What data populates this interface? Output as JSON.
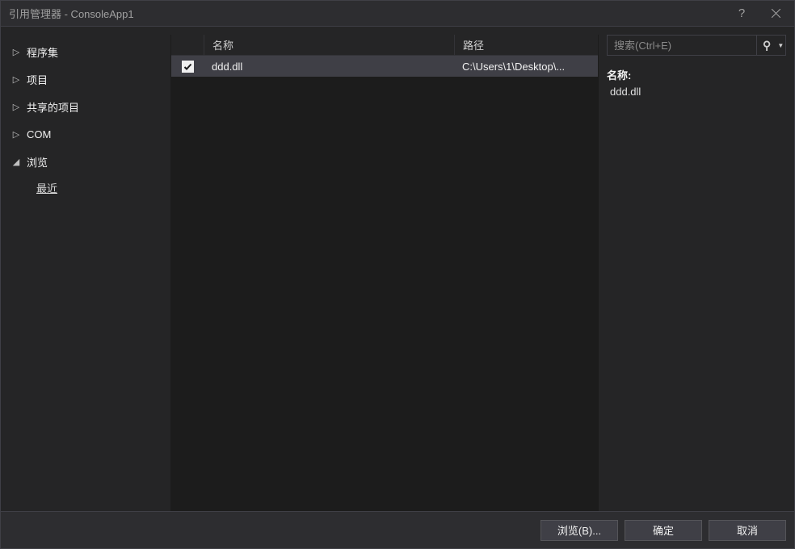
{
  "window": {
    "title": "引用管理器 - ConsoleApp1"
  },
  "sidebar": {
    "items": [
      {
        "label": "程序集",
        "expanded": false
      },
      {
        "label": "项目",
        "expanded": false
      },
      {
        "label": "共享的项目",
        "expanded": false
      },
      {
        "label": "COM",
        "expanded": false
      },
      {
        "label": "浏览",
        "expanded": true
      }
    ],
    "browse_sub": "最近"
  },
  "list": {
    "headers": {
      "name": "名称",
      "path": "路径"
    },
    "rows": [
      {
        "checked": true,
        "name": "ddd.dll",
        "path": "C:\\Users\\1\\Desktop\\..."
      }
    ]
  },
  "search": {
    "placeholder": "搜索(Ctrl+E)"
  },
  "details": {
    "name_label": "名称:",
    "name_value": "ddd.dll"
  },
  "footer": {
    "browse": "浏览(B)...",
    "ok": "确定",
    "cancel": "取消"
  }
}
